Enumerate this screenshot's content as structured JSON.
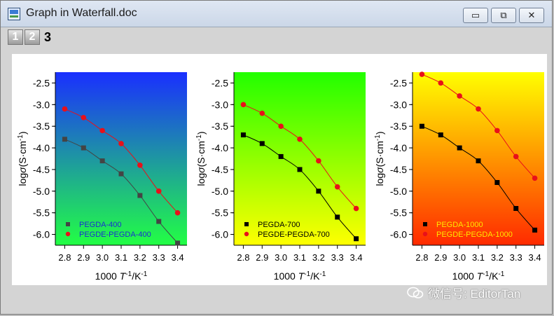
{
  "window": {
    "title": "Graph in Waterfall.doc",
    "buttons": {
      "minimize": "▭",
      "restore": "⧉",
      "close": "✕"
    }
  },
  "layers": [
    "1",
    "2",
    "3"
  ],
  "watermark": {
    "text": "微信号: EditorTan",
    "icon": "wechat-icon"
  },
  "chart_data": [
    {
      "type": "line",
      "background_gradient": [
        "#1a2fff",
        "#22ff44"
      ],
      "xlabel": {
        "main": "1000 ",
        "t": "T",
        "sup": "-1",
        "unit": "/K",
        "unit_sup": "-1"
      },
      "ylabel": {
        "main": "log",
        "sigma": "σ",
        "unit": "(S·cm",
        "sup": "-1",
        "close": ")"
      },
      "xlim": [
        2.75,
        3.45
      ],
      "ylim": [
        -6.25,
        -2.25
      ],
      "x_ticks": [
        2.8,
        2.9,
        3.0,
        3.1,
        3.2,
        3.3,
        3.4
      ],
      "x_tick_labels": [
        "2.8",
        "2.9",
        "3.0",
        "3.1",
        "3.2",
        "3.3",
        "3.4"
      ],
      "y_ticks": [
        -2.5,
        -3.0,
        -3.5,
        -4.0,
        -4.5,
        -5.0,
        -5.5,
        -6.0
      ],
      "y_tick_labels": [
        "-2.5",
        "-3.0",
        "-3.5",
        "-4.0",
        "-4.5",
        "-5.0",
        "-5.5",
        "-6.0"
      ],
      "legend_color": "#1a2fd0",
      "legend_placement": "bottom-left",
      "series": [
        {
          "name": "PEGDA-400",
          "marker": "square",
          "color": "#444444",
          "line_color": "#444444",
          "x": [
            2.8,
            2.9,
            3.0,
            3.1,
            3.2,
            3.3,
            3.4
          ],
          "y": [
            -3.8,
            -4.0,
            -4.3,
            -4.6,
            -5.1,
            -5.7,
            -6.2
          ]
        },
        {
          "name": "PEGDE-PEGDA-400",
          "marker": "circle",
          "color": "#e8101a",
          "line_color": "#e8101a",
          "x": [
            2.8,
            2.9,
            3.0,
            3.1,
            3.2,
            3.3,
            3.4
          ],
          "y": [
            -3.1,
            -3.3,
            -3.6,
            -3.9,
            -4.4,
            -5.0,
            -5.5
          ]
        }
      ]
    },
    {
      "type": "line",
      "background_gradient": [
        "#22ff00",
        "#ffff00"
      ],
      "xlabel": {
        "main": "1000 ",
        "t": "T",
        "sup": "-1",
        "unit": "/K",
        "unit_sup": "-1"
      },
      "ylabel": {
        "main": "log",
        "sigma": "σ",
        "unit": "(S·cm",
        "sup": "-1",
        "close": ")"
      },
      "xlim": [
        2.75,
        3.45
      ],
      "ylim": [
        -6.25,
        -2.25
      ],
      "x_ticks": [
        2.8,
        2.9,
        3.0,
        3.1,
        3.2,
        3.3,
        3.4
      ],
      "x_tick_labels": [
        "2.8",
        "2.9",
        "3.0",
        "3.1",
        "3.2",
        "3.3",
        "3.4"
      ],
      "y_ticks": [
        -2.5,
        -3.0,
        -3.5,
        -4.0,
        -4.5,
        -5.0,
        -5.5,
        -6.0
      ],
      "y_tick_labels": [
        "-2.5",
        "-3.0",
        "-3.5",
        "-4.0",
        "-4.5",
        "-5.0",
        "-5.5",
        "-6.0"
      ],
      "legend_color": "#000000",
      "legend_placement": "bottom-left",
      "series": [
        {
          "name": "PEGDA-700",
          "marker": "square",
          "color": "#000000",
          "line_color": "#000000",
          "x": [
            2.8,
            2.9,
            3.0,
            3.1,
            3.2,
            3.3,
            3.4
          ],
          "y": [
            -3.7,
            -3.9,
            -4.2,
            -4.5,
            -5.0,
            -5.6,
            -6.1
          ]
        },
        {
          "name": "PEGDE-PEGDA-700",
          "marker": "circle",
          "color": "#e8101a",
          "line_color": "#e8101a",
          "x": [
            2.8,
            2.9,
            3.0,
            3.1,
            3.2,
            3.3,
            3.4
          ],
          "y": [
            -3.0,
            -3.2,
            -3.5,
            -3.8,
            -4.3,
            -4.9,
            -5.4
          ]
        }
      ]
    },
    {
      "type": "line",
      "background_gradient": [
        "#ffff00",
        "#ff2a00"
      ],
      "xlabel": {
        "main": "1000 ",
        "t": "T",
        "sup": "-1",
        "unit": "/K",
        "unit_sup": "-1"
      },
      "ylabel": {
        "main": "log",
        "sigma": "σ",
        "unit": "(S·cm",
        "sup": "-1",
        "close": ")"
      },
      "xlim": [
        2.75,
        3.45
      ],
      "ylim": [
        -6.25,
        -2.25
      ],
      "x_ticks": [
        2.8,
        2.9,
        3.0,
        3.1,
        3.2,
        3.3,
        3.4
      ],
      "x_tick_labels": [
        "2.8",
        "2.9",
        "3.0",
        "3.1",
        "3.2",
        "3.3",
        "3.4"
      ],
      "y_ticks": [
        -2.5,
        -3.0,
        -3.5,
        -4.0,
        -4.5,
        -5.0,
        -5.5,
        -6.0
      ],
      "y_tick_labels": [
        "-2.5",
        "-3.0",
        "-3.5",
        "-4.0",
        "-4.5",
        "-5.0",
        "-5.5",
        "-6.0"
      ],
      "legend_color": "#ffe600",
      "legend_placement": "bottom-left",
      "series": [
        {
          "name": "PEGDA-1000",
          "marker": "square",
          "color": "#000000",
          "line_color": "#000000",
          "x": [
            2.8,
            2.9,
            3.0,
            3.1,
            3.2,
            3.3,
            3.4
          ],
          "y": [
            -3.5,
            -3.7,
            -4.0,
            -4.3,
            -4.8,
            -5.4,
            -5.9
          ]
        },
        {
          "name": "PEGDE-PEGDA-1000",
          "marker": "circle",
          "color": "#e8101a",
          "line_color": "#e8101a",
          "x": [
            2.8,
            2.9,
            3.0,
            3.1,
            3.2,
            3.3,
            3.4
          ],
          "y": [
            -2.3,
            -2.5,
            -2.8,
            -3.1,
            -3.6,
            -4.2,
            -4.7
          ]
        }
      ]
    }
  ]
}
